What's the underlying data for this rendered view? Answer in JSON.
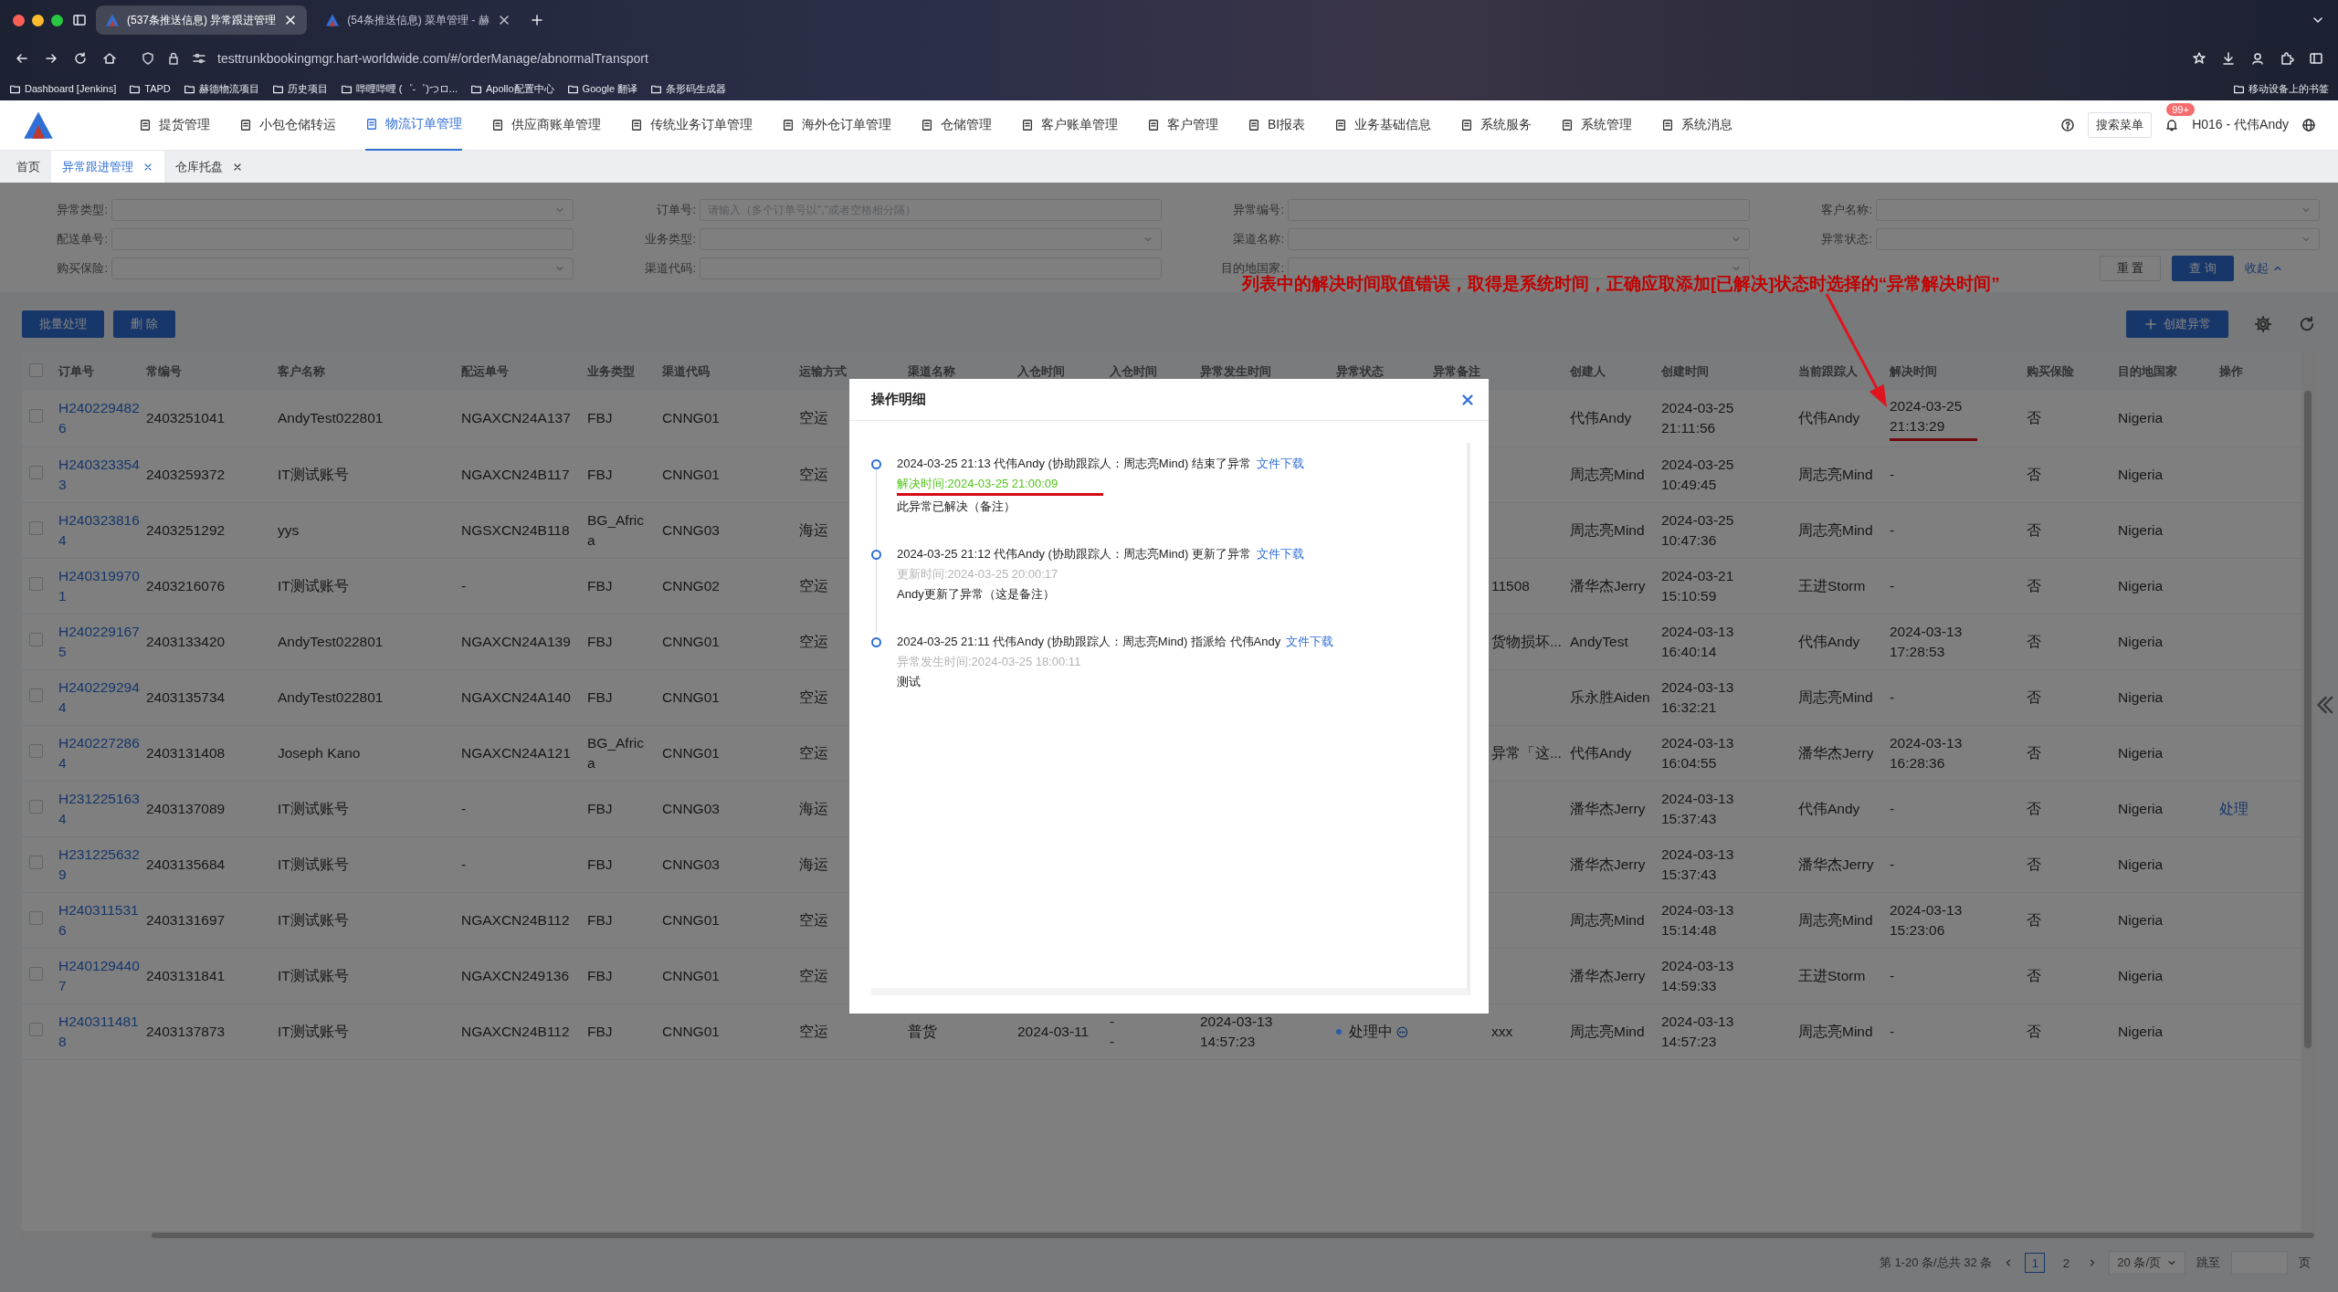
{
  "browser": {
    "tabs": [
      {
        "title": "(537条推送信息) 异常跟进管理",
        "selected": true
      },
      {
        "title": "(54条推送信息) 菜单管理 - 赫",
        "selected": false
      }
    ],
    "url": "testtrunkbookingmgr.hart-worldwide.com/#/orderManage/abnormalTransport",
    "bookmarks": [
      "Dashboard [Jenkins]",
      "TAPD",
      "赫德物流项目",
      "历史项目",
      "哔哩哔哩 (゜-゜)つロ...",
      "Apollo配置中心",
      "Google 翻译",
      "条形码生成器"
    ],
    "mobile_bookmarks": "移动设备上的书签"
  },
  "nav": {
    "items": [
      {
        "label": "提货管理",
        "selected": false
      },
      {
        "label": "小包仓储转运",
        "selected": false
      },
      {
        "label": "物流订单管理",
        "selected": true
      },
      {
        "label": "供应商账单管理",
        "selected": false
      },
      {
        "label": "传统业务订单管理",
        "selected": false
      },
      {
        "label": "海外仓订单管理",
        "selected": false
      },
      {
        "label": "仓储管理",
        "selected": false
      },
      {
        "label": "客户账单管理",
        "selected": false
      },
      {
        "label": "客户管理",
        "selected": false
      },
      {
        "label": "BI报表",
        "selected": false
      },
      {
        "label": "业务基础信息",
        "selected": false
      },
      {
        "label": "系统服务",
        "selected": false
      },
      {
        "label": "系统管理",
        "selected": false
      },
      {
        "label": "系统消息",
        "selected": false
      }
    ],
    "search_menu": "搜索菜单",
    "badge": "99+",
    "user": "H016 - 代伟Andy"
  },
  "page_tabs": [
    {
      "label": "首页",
      "selected": false,
      "closable": false
    },
    {
      "label": "异常跟进管理",
      "selected": true,
      "closable": true
    },
    {
      "label": "仓库托盘",
      "selected": false,
      "closable": true
    }
  ],
  "filters": [
    {
      "label": "异常类型:",
      "kind": "select"
    },
    {
      "label": "订单号:",
      "kind": "input",
      "placeholder": "请输入（多个订单号以\",\"或者空格相分隔）"
    },
    {
      "label": "异常编号:",
      "kind": "input"
    },
    {
      "label": "客户名称:",
      "kind": "select"
    },
    {
      "label": "配送单号:",
      "kind": "input"
    },
    {
      "label": "业务类型:",
      "kind": "select"
    },
    {
      "label": "渠道名称:",
      "kind": "select"
    },
    {
      "label": "异常状态:",
      "kind": "select"
    },
    {
      "label": "购买保险:",
      "kind": "select"
    },
    {
      "label": "渠道代码:",
      "kind": "input"
    },
    {
      "label": "目的地国家:",
      "kind": "select"
    }
  ],
  "filter_actions": {
    "reset": "重 置",
    "search": "查 询",
    "collapse": "收起"
  },
  "annotation": {
    "text": "列表中的解决时间取值错误，取得是系统时间，正确应取添加[已解决]状态时选择的“异常解决时间”"
  },
  "toolbar": {
    "buttons": [
      "批量处理",
      "删 除"
    ],
    "create": "创建异常"
  },
  "table": {
    "all_checked": false,
    "columns": [
      {
        "label": "订单号",
        "kind": "link"
      },
      {
        "label": "常编号",
        "kind": "text"
      },
      {
        "label": "客户名称",
        "kind": "text"
      },
      {
        "label": "配运单号",
        "kind": "text"
      },
      {
        "label": "业务类型",
        "kind": "text"
      },
      {
        "label": "渠道代码",
        "kind": "text"
      },
      {
        "label": "运输方式",
        "kind": "text"
      },
      {
        "label": "渠道名称",
        "kind": "text"
      },
      {
        "label": "入仓时间",
        "kind": "text"
      },
      {
        "label": "入仓时间",
        "kind": "text"
      },
      {
        "label": "异常发生时间",
        "kind": "text"
      },
      {
        "label": "异常状态",
        "kind": "status"
      },
      {
        "label": "异常备注",
        "kind": "remark"
      },
      {
        "label": "创建人",
        "kind": "text"
      },
      {
        "label": "创建时间",
        "kind": "text"
      },
      {
        "label": "当前跟踪人",
        "kind": "text"
      },
      {
        "label": "解决时间",
        "kind": "text"
      },
      {
        "label": "购买保险",
        "kind": "text"
      },
      {
        "label": "目的地国家",
        "kind": "text"
      },
      {
        "label": "操作",
        "kind": "action"
      }
    ],
    "rows": [
      {
        "checked": false,
        "annotated": true,
        "cells": [
          "H2402294826",
          "2403251041",
          "AndyTest022801",
          "NGAXCN24A137",
          "FBJ",
          "CNNG01",
          "空运",
          null,
          null,
          null,
          null,
          null,
          null,
          "代伟Andy",
          "2024-03-25 21:11:56",
          "代伟Andy",
          "2024-03-25 21:13:29",
          "否",
          "Nigeria",
          null
        ]
      },
      {
        "checked": false,
        "annotated": false,
        "cells": [
          "H2403233543",
          "2403259372",
          "IT测试账号",
          "NGAXCN24B117",
          "FBJ",
          "CNNG01",
          "空运",
          null,
          null,
          null,
          null,
          null,
          null,
          "周志亮Mind",
          "2024-03-25 10:49:45",
          "周志亮Mind",
          "-",
          "否",
          "Nigeria",
          null
        ]
      },
      {
        "checked": false,
        "annotated": false,
        "cells": [
          "H2403238164",
          "2403251292",
          "yys",
          "NGSXCN24B118",
          "BG_Africa",
          "CNNG03",
          "海运",
          null,
          null,
          null,
          null,
          null,
          null,
          "周志亮Mind",
          "2024-03-25 10:47:36",
          "周志亮Mind",
          "-",
          "否",
          "Nigeria",
          null
        ]
      },
      {
        "checked": false,
        "annotated": false,
        "cells": [
          "H2403199701",
          "2403216076",
          "IT测试账号",
          "-",
          "FBJ",
          "CNNG02",
          "空运",
          null,
          null,
          null,
          null,
          null,
          "11508",
          "潘华杰Jerry",
          "2024-03-21 15:10:59",
          "王进Storm",
          "-",
          "否",
          "Nigeria",
          null
        ]
      },
      {
        "checked": false,
        "annotated": false,
        "cells": [
          "H2402291675",
          "2403133420",
          "AndyTest022801",
          "NGAXCN24A139",
          "FBJ",
          "CNNG01",
          "空运",
          null,
          null,
          null,
          null,
          null,
          "货物损坏...",
          "AndyTest",
          "2024-03-13 16:40:14",
          "代伟Andy",
          "2024-03-13 17:28:53",
          "否",
          "Nigeria",
          null
        ]
      },
      {
        "checked": false,
        "annotated": false,
        "cells": [
          "H2402292944",
          "2403135734",
          "AndyTest022801",
          "NGAXCN24A140",
          "FBJ",
          "CNNG01",
          "空运",
          null,
          null,
          null,
          null,
          null,
          null,
          "乐永胜Aiden",
          "2024-03-13 16:32:21",
          "周志亮Mind",
          "-",
          "否",
          "Nigeria",
          null
        ]
      },
      {
        "checked": false,
        "annotated": false,
        "cells": [
          "H2402272864",
          "2403131408",
          "Joseph Kano",
          "NGAXCN24A121",
          "BG_Africa",
          "CNNG01",
          "空运",
          null,
          null,
          null,
          null,
          null,
          "异常「这...",
          "代伟Andy",
          "2024-03-13 16:04:55",
          "潘华杰Jerry",
          "2024-03-13 16:28:36",
          "否",
          "Nigeria",
          null
        ]
      },
      {
        "checked": false,
        "annotated": false,
        "cells": [
          "H2312251634",
          "2403137089",
          "IT测试账号",
          "-",
          "FBJ",
          "CNNG03",
          "海运",
          null,
          null,
          null,
          null,
          null,
          null,
          "潘华杰Jerry",
          "2024-03-13 15:37:43",
          "代伟Andy",
          "-",
          "否",
          "Nigeria",
          "处理"
        ]
      },
      {
        "checked": false,
        "annotated": false,
        "cells": [
          "H2312256329",
          "2403135684",
          "IT测试账号",
          "-",
          "FBJ",
          "CNNG03",
          "海运",
          null,
          null,
          null,
          null,
          null,
          null,
          "潘华杰Jerry",
          "2024-03-13 15:37:43",
          "潘华杰Jerry",
          "-",
          "否",
          "Nigeria",
          null
        ]
      },
      {
        "checked": false,
        "annotated": false,
        "cells": [
          "H2403115316",
          "2403131697",
          "IT测试账号",
          "NGAXCN24B112",
          "FBJ",
          "CNNG01",
          "空运",
          null,
          null,
          null,
          null,
          null,
          null,
          "周志亮Mind",
          "2024-03-13 15:14:48",
          "周志亮Mind",
          "2024-03-13 15:23:06",
          "否",
          "Nigeria",
          null
        ]
      },
      {
        "checked": false,
        "annotated": false,
        "cells": [
          "H2401294407",
          "2403131841",
          "IT测试账号",
          "NGAXCN249136",
          "FBJ",
          "CNNG01",
          "空运",
          null,
          null,
          null,
          null,
          null,
          null,
          "潘华杰Jerry",
          "2024-03-13 14:59:33",
          "王进Storm",
          "-",
          "否",
          "Nigeria",
          null
        ]
      },
      {
        "checked": false,
        "annotated": false,
        "cells": [
          "H2403114818",
          "2403137873",
          "IT测试账号",
          "NGAXCN24B112",
          "FBJ",
          "CNNG01",
          "空运",
          "普货",
          "2024-03-11",
          "-\n-",
          "2024-03-13 14:57:23",
          {
            "text": "处理中",
            "color": "#2c5aa8"
          },
          "xxx",
          "周志亮Mind",
          "2024-03-13 14:57:23",
          "周志亮Mind",
          "-",
          "否",
          "Nigeria",
          null
        ]
      }
    ]
  },
  "pagination": {
    "summary": "第 1-20 条/总共 32 条",
    "pages": [
      {
        "label": "1",
        "selected": true
      },
      {
        "label": "2",
        "selected": false
      }
    ],
    "page_size": "20 条/页",
    "jump_label": "跳至",
    "jump_suffix": "页"
  },
  "modal": {
    "title": "操作明细",
    "entries": [
      {
        "heading": "2024-03-25 21:13 代伟Andy (协助跟踪人：周志亮Mind) 结束了异常",
        "link": "文件下载",
        "time": "解决时间:2024-03-25 21:00:09",
        "color": "#52c41a",
        "annotated": true,
        "note": "此异常已解决（备注）"
      },
      {
        "heading": "2024-03-25 21:12 代伟Andy (协助跟踪人：周志亮Mind) 更新了异常",
        "link": "文件下载",
        "time": "更新时间:2024-03-25 20:00:17",
        "color": "#b4b4b4",
        "annotated": false,
        "note": "Andy更新了异常（这是备注）"
      },
      {
        "heading": "2024-03-25 21:11 代伟Andy (协助跟踪人：周志亮Mind) 指派给 代伟Andy",
        "link": "文件下载",
        "time": "异常发生时间:2024-03-25 18:00:11",
        "color": "#b4b4b4",
        "annotated": false,
        "note": "测试"
      }
    ]
  }
}
